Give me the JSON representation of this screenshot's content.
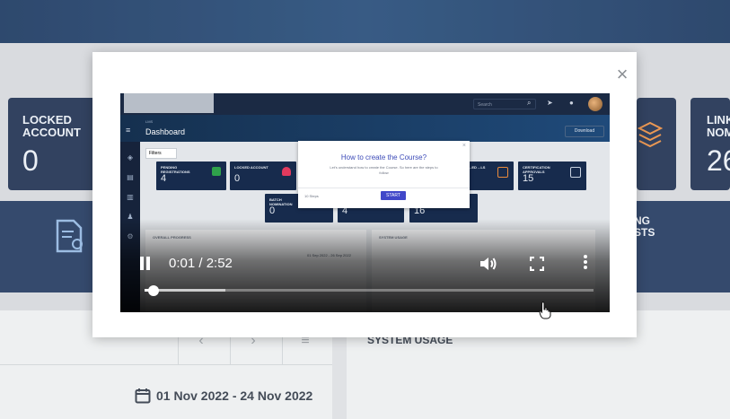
{
  "background": {
    "cards": [
      {
        "title": "LOCKED ACCOUNT",
        "value": "0"
      },
      {
        "title": "LINK NOM",
        "value": "26"
      }
    ],
    "strip_label": "NG\nSTS",
    "panel_title": "SYSTEM USAGE",
    "date_range": "01 Nov 2022 - 24 Nov 2022"
  },
  "modal": {
    "close_symbol": "×",
    "video": {
      "current_time": "0:01",
      "duration": "2:52",
      "time_display": "0:01 / 2:52",
      "progress_fraction": 0.02,
      "buffered_fraction": 0.18,
      "frame": {
        "search_placeholder": "Search",
        "lms": "LMS",
        "dashboard_title": "Dashboard",
        "download_label": "Download",
        "filters_label": "Filters",
        "cards": [
          {
            "title": "PENDING REGISTRATIONS",
            "value": "4"
          },
          {
            "title": "LOCKED ACCOUNT",
            "value": "0"
          },
          {
            "title": "...ED ...LS",
            "value": ""
          },
          {
            "title": "CERTIFICATION APPROVALS",
            "value": "15"
          },
          {
            "title": "BATCH NOMINATION",
            "value": "0"
          },
          {
            "title": "",
            "value": "4"
          },
          {
            "title": "",
            "value": "16"
          }
        ],
        "panel_left": "OVERALL PROGRESS",
        "panel_right": "SYSTEM USAGE",
        "panel_date": "01 Sep 2022 - 26 Sep 2022",
        "popup": {
          "question": "How to create the Course?",
          "subtitle": "Let's understand how to create the Course. So here are the steps to follow",
          "steps": "10 Steps",
          "start_label": "START"
        }
      }
    }
  },
  "colors": {
    "header": "#12305a",
    "card": "#16284a",
    "modal_bg": "#ffffff",
    "popup_accent": "#4148c9"
  }
}
